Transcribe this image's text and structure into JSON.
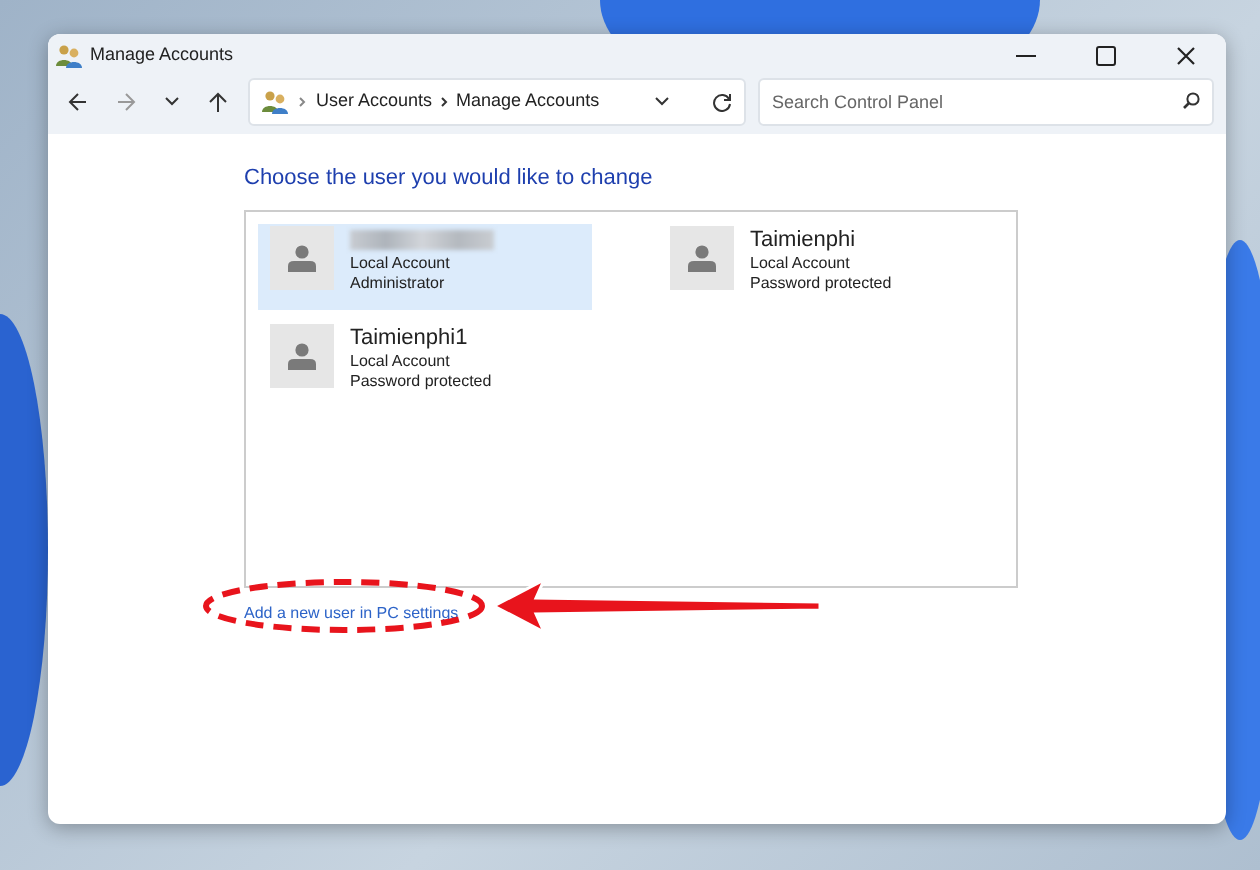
{
  "window": {
    "title": "Manage Accounts"
  },
  "address_bar": {
    "breadcrumbs": [
      "User Accounts",
      "Manage Accounts"
    ]
  },
  "search": {
    "placeholder": "Search Control Panel"
  },
  "heading": "Choose the user you would like to change",
  "users": [
    {
      "name_hidden": true,
      "lines": [
        "Local Account",
        "Administrator"
      ],
      "selected": true
    },
    {
      "name": "Taimienphi",
      "lines": [
        "Local Account",
        "Password protected"
      ],
      "selected": false
    },
    {
      "name": "Taimienphi1",
      "lines": [
        "Local Account",
        "Password protected"
      ],
      "selected": false
    }
  ],
  "add_user_link": "Add a new user in PC settings"
}
